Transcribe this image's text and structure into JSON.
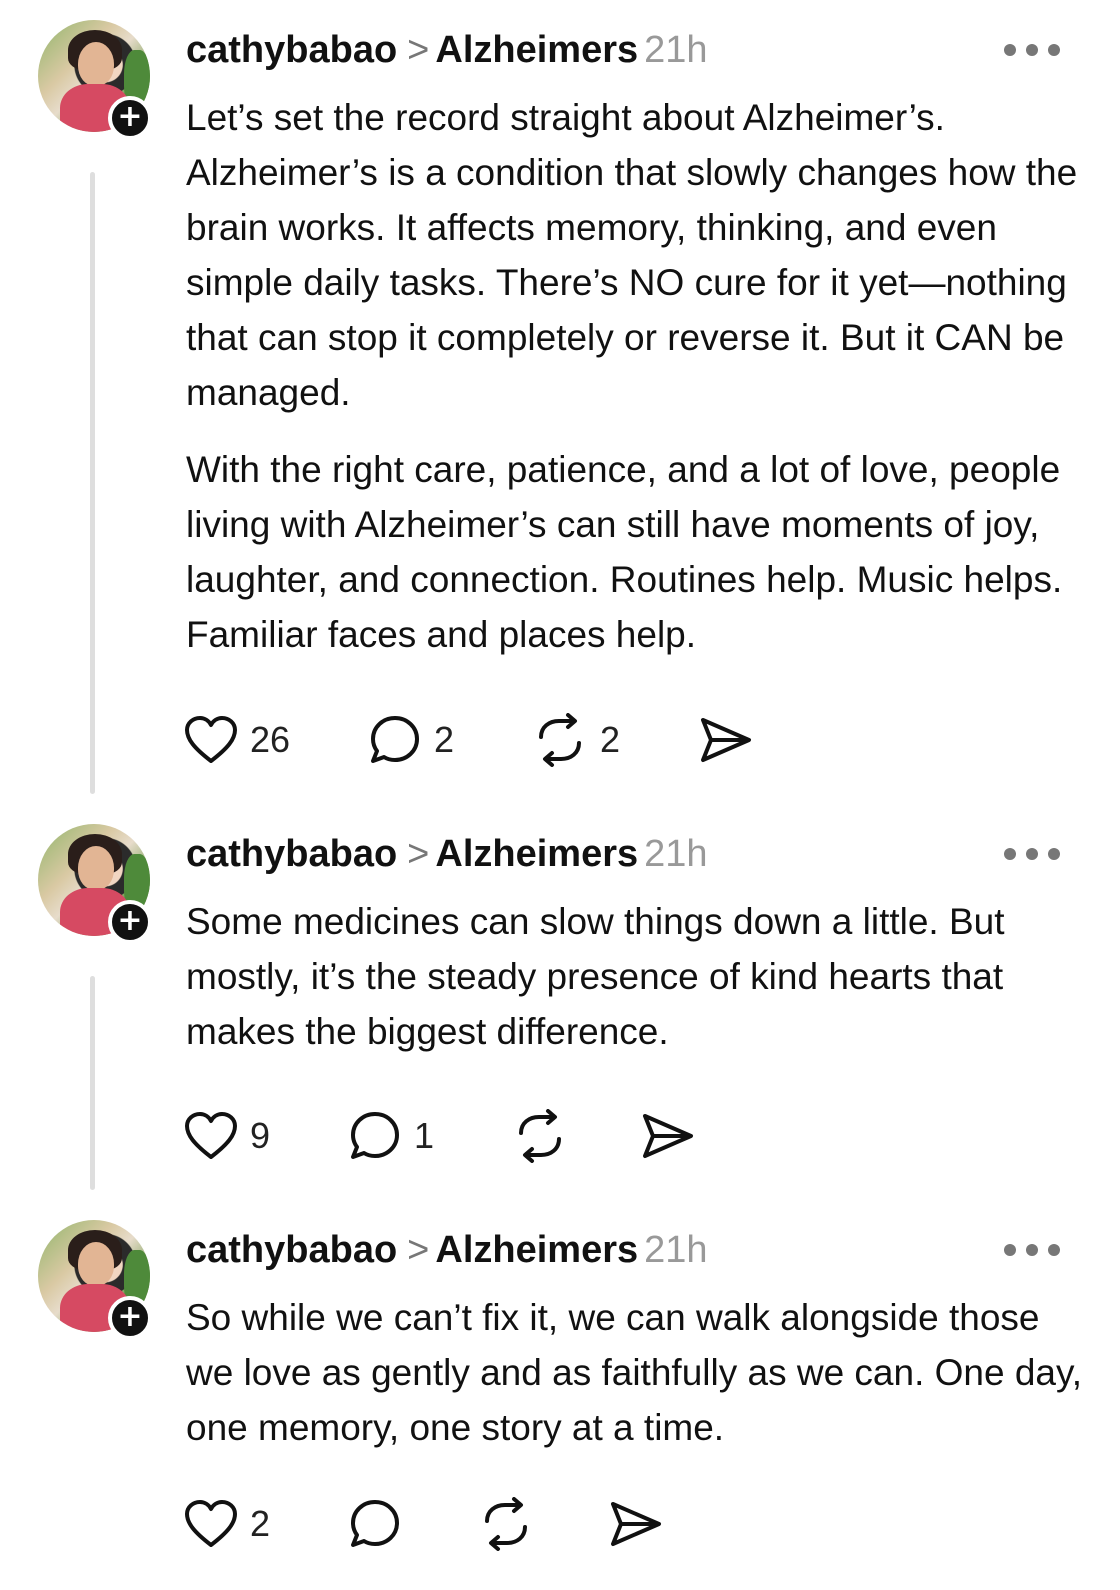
{
  "posts": [
    {
      "username": "cathybabao",
      "chevron": ">",
      "topic": "Alzheimers",
      "time": "21h",
      "paragraphs": [
        "Let’s set the record straight about Alzheimer’s. Alzheimer’s is a condition that slowly changes how the brain works. It affects memory, thinking, and even simple daily tasks. There’s NO cure for it yet—nothing that can stop it completely or reverse it. But it CAN be managed.",
        "With the right care, patience, and a lot of love, people living with Alzheimer’s can still have moments of joy, laughter, and connection. Routines help. Music helps. Familiar faces and places help."
      ],
      "likes": "26",
      "replies": "2",
      "reposts": "2"
    },
    {
      "username": "cathybabao",
      "chevron": ">",
      "topic": "Alzheimers",
      "time": "21h",
      "paragraphs": [
        "Some medicines can slow things down a little. But mostly, it’s the steady presence of kind hearts that makes the biggest difference."
      ],
      "likes": "9",
      "replies": "1",
      "reposts": ""
    },
    {
      "username": "cathybabao",
      "chevron": ">",
      "topic": "Alzheimers",
      "time": "21h",
      "paragraphs": [
        "So while we can’t fix it, we can walk alongside those we love as gently and as faithfully as we can. One day, one memory, one story at a time."
      ],
      "likes": "2",
      "replies": "",
      "reposts": ""
    }
  ],
  "icons": {
    "follow": "plus-icon",
    "more": "more-horizontal-icon",
    "like": "heart-icon",
    "reply": "comment-icon",
    "repost": "repost-icon",
    "share": "send-icon"
  },
  "colors": {
    "text": "#111111",
    "muted": "#999999",
    "thread_line": "#dedede"
  }
}
